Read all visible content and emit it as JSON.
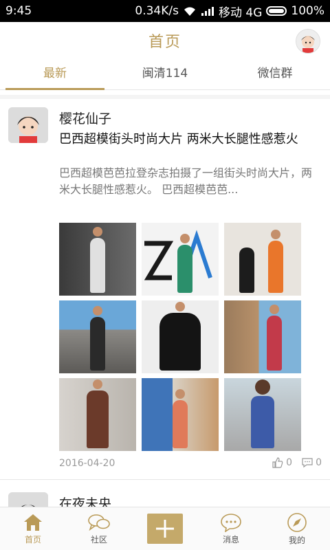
{
  "status_bar": {
    "time": "9:45",
    "net_speed": "0.34K/s",
    "carrier": "移动 4G",
    "battery": "100%"
  },
  "header": {
    "title": "首页"
  },
  "tabs": [
    {
      "label": "最新",
      "active": true
    },
    {
      "label": "闽清114",
      "active": false
    },
    {
      "label": "微信群",
      "active": false
    }
  ],
  "post": {
    "author": "樱花仙子",
    "title": "巴西超模街头时尚大片 两米大长腿性感惹火",
    "summary": "巴西超模芭芭拉登杂志拍摄了一组街头时尚大片，两米大长腿性感惹火。 巴西超模芭芭...",
    "date": "2016-04-20",
    "likes": "0",
    "comments": "0"
  },
  "post2": {
    "author": "在夜未央"
  },
  "bottom_nav": [
    {
      "label": "首页",
      "icon": "home-icon",
      "active": true
    },
    {
      "label": "社区",
      "icon": "chat-bubbles-icon",
      "active": false
    },
    {
      "label": "+",
      "icon": "add-icon",
      "active": false
    },
    {
      "label": "消息",
      "icon": "message-icon",
      "active": false
    },
    {
      "label": "我的",
      "icon": "compass-icon",
      "active": false
    }
  ],
  "colors": {
    "accent": "#b99a57",
    "add_button": "#c4a96a"
  }
}
